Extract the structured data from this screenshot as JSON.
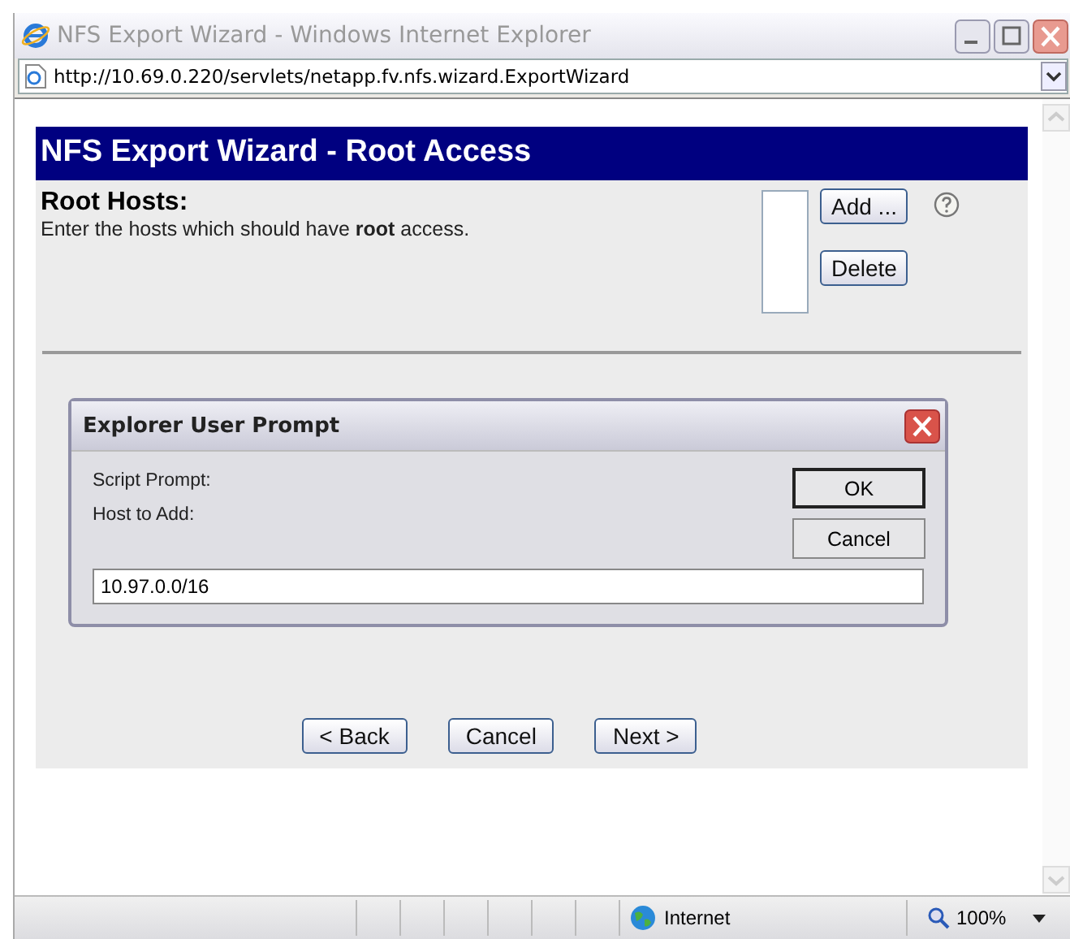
{
  "window": {
    "title": "NFS Export Wizard - Windows Internet Explorer"
  },
  "address_bar": {
    "url": "http://10.69.0.220/servlets/netapp.fv.nfs.wizard.ExportWizard"
  },
  "wizard": {
    "title": "NFS Export Wizard - Root Access",
    "heading": "Root Hosts:",
    "description": "Enter the hosts which should have **root** access.",
    "host_buttons": [
      "Add ...",
      "Delete"
    ],
    "nav_buttons": [
      "< Back",
      "Cancel",
      "Next >"
    ]
  },
  "dialog": {
    "title": "Explorer User Prompt",
    "labels": [
      "Script Prompt:",
      "Host to Add:"
    ],
    "buttons": [
      {
        "label": "OK",
        "default": true
      },
      {
        "label": "Cancel",
        "default": false
      }
    ],
    "value": "10.97.0.0/16"
  },
  "status_bar": {
    "zone": "Internet",
    "zoom": "100%"
  }
}
